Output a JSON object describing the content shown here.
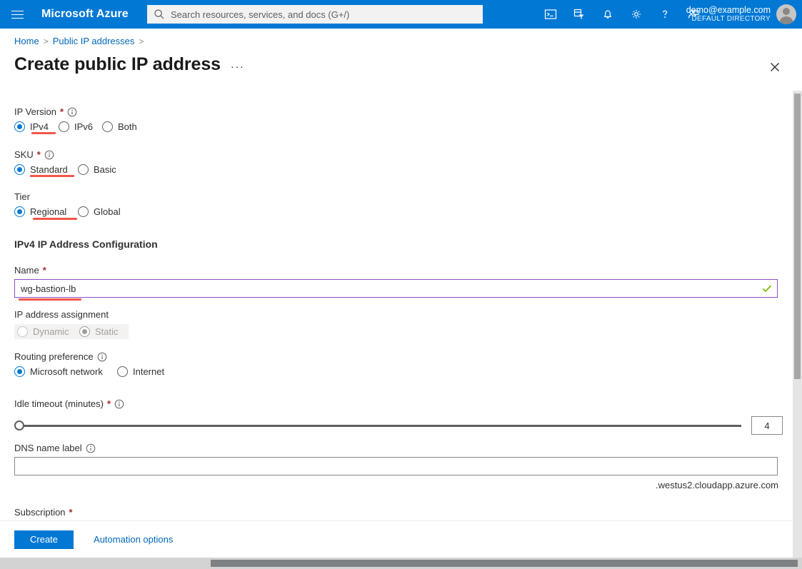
{
  "header": {
    "brand": "Microsoft Azure",
    "menu_icon": "hamburger-icon",
    "search_placeholder": "Search resources, services, and docs (G+/)",
    "icons": [
      {
        "name": "cloud-shell-icon"
      },
      {
        "name": "directories-subscriptions-icon"
      },
      {
        "name": "notifications-bell-icon"
      },
      {
        "name": "settings-gear-icon"
      },
      {
        "name": "help-question-icon"
      },
      {
        "name": "feedback-icon"
      }
    ],
    "account_email": "demo@example.com",
    "account_directory": "DEFAULT DIRECTORY"
  },
  "breadcrumb": {
    "home": "Home",
    "parent": "Public IP addresses",
    "separator": ">"
  },
  "page": {
    "title": "Create public IP address",
    "ellipsis": "···",
    "close_icon": "close-icon"
  },
  "form": {
    "ip_version": {
      "label": "IP Version",
      "required": "*",
      "options": [
        "IPv4",
        "IPv6",
        "Both"
      ],
      "selected": "IPv4"
    },
    "sku": {
      "label": "SKU",
      "required": "*",
      "options": [
        "Standard",
        "Basic"
      ],
      "selected": "Standard"
    },
    "tier": {
      "label": "Tier",
      "options": [
        "Regional",
        "Global"
      ],
      "selected": "Regional"
    },
    "config_section": "IPv4 IP Address Configuration",
    "name": {
      "label": "Name",
      "required": "*",
      "value": "wg-bastion-lb",
      "valid_icon": "checkmark-icon"
    },
    "ip_assignment": {
      "label": "IP address assignment",
      "options": [
        "Dynamic",
        "Static"
      ],
      "selected": "Static",
      "disabled": true
    },
    "routing_preference": {
      "label": "Routing preference",
      "options": [
        "Microsoft network",
        "Internet"
      ],
      "selected": "Microsoft network"
    },
    "idle_timeout": {
      "label": "Idle timeout (minutes)",
      "required": "*",
      "value": "4",
      "min": "4",
      "max": "30"
    },
    "dns_name_label": {
      "label": "DNS name label",
      "value": "",
      "suffix": ".westus2.cloudapp.azure.com"
    },
    "subscription": {
      "label": "Subscription",
      "required": "*"
    }
  },
  "footer": {
    "create_label": "Create",
    "automation_label": "Automation options"
  },
  "colors": {
    "azure_blue": "#0078d4",
    "link_blue": "#0067b8",
    "required_red": "#a4262c",
    "annotation_red": "#f4554a",
    "focus_purple": "#8e4ec6",
    "valid_green": "#7cbb00"
  }
}
